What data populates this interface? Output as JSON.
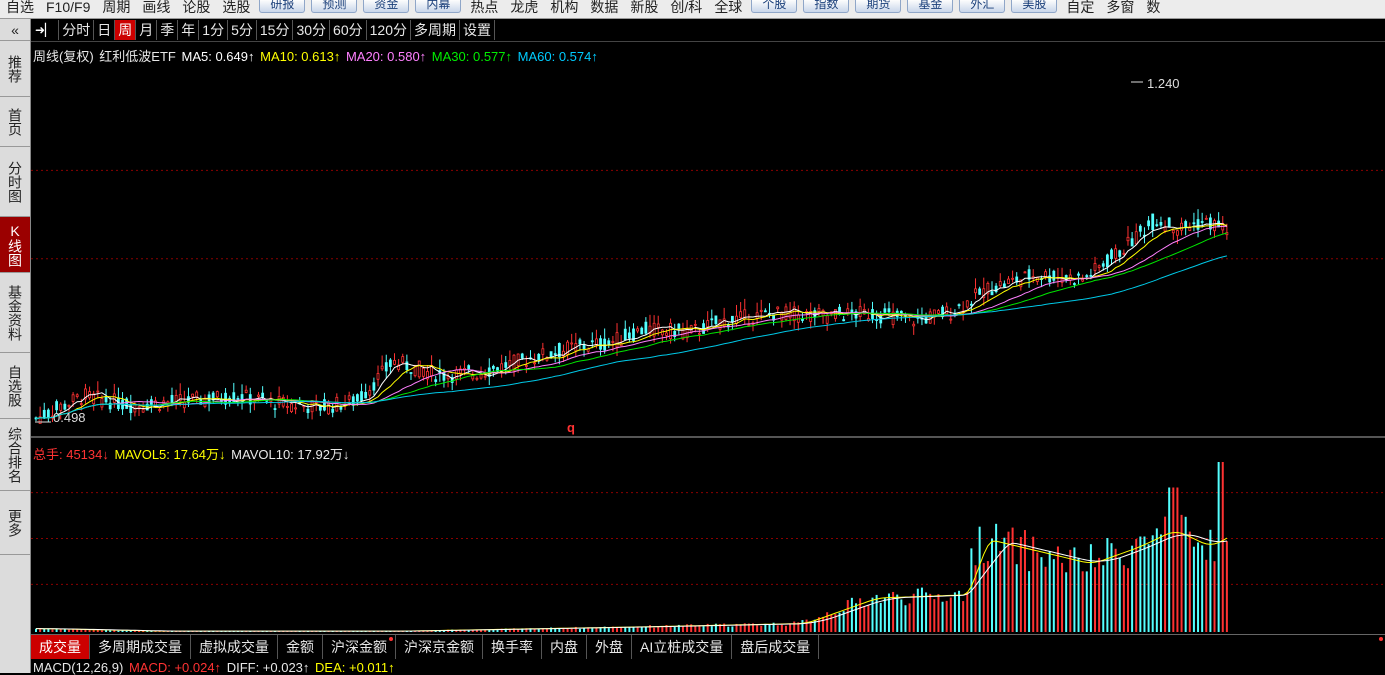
{
  "topbar": {
    "items": [
      "自选",
      "F10/F9",
      "周期",
      "画线",
      "论股",
      "选股"
    ],
    "buttons": [
      "研报",
      "预测",
      "资金",
      "内幕"
    ],
    "items2": [
      "热点",
      "龙虎",
      "机构",
      "数据",
      "新股",
      "创/科",
      "全球"
    ],
    "buttons2": [
      "个股",
      "指数",
      "期货",
      "基金",
      "外汇",
      "美股"
    ],
    "items3": [
      "自定",
      "多窗",
      "数"
    ]
  },
  "sidebar": {
    "collapse_icon": "double-chevron-left-icon",
    "collapse_glyph": "«",
    "items": [
      {
        "label": "推荐",
        "active": false
      },
      {
        "label": "首页",
        "active": false
      },
      {
        "label": "分时图",
        "active": false
      },
      {
        "label": "K线图",
        "active": true
      },
      {
        "label": "基金资料",
        "active": false
      },
      {
        "label": "自选股",
        "active": false
      },
      {
        "label": "综合排名",
        "active": false
      },
      {
        "label": "更多",
        "active": false
      }
    ]
  },
  "period_bar": {
    "pin_icon": "pin-arrow-icon",
    "pin_glyph": "➜▏",
    "items": [
      {
        "label": "分时",
        "active": false
      },
      {
        "label": "日",
        "active": false
      },
      {
        "label": "周",
        "active": true
      },
      {
        "label": "月",
        "active": false
      },
      {
        "label": "季",
        "active": false
      },
      {
        "label": "年",
        "active": false
      },
      {
        "label": "1分",
        "active": false
      },
      {
        "label": "5分",
        "active": false
      },
      {
        "label": "15分",
        "active": false
      },
      {
        "label": "30分",
        "active": false
      },
      {
        "label": "60分",
        "active": false
      },
      {
        "label": "120分",
        "active": false
      },
      {
        "label": "多周期",
        "active": false
      },
      {
        "label": "设置",
        "active": false
      }
    ]
  },
  "ma_legend": {
    "title": "周线(复权)",
    "name": "红利低波ETF",
    "ma5": "MA5: 0.649↑",
    "ma10": "MA10: 0.613↑",
    "ma20": "MA20: 0.580↑",
    "ma30": "MA30: 0.577↑",
    "ma60": "MA60: 0.574↑"
  },
  "price_marks": {
    "high": "1.240",
    "low": "0.498",
    "q_marker": "q"
  },
  "vol_legend": {
    "total": "总手: 45134↓",
    "mavol5": "MAVOL5: 17.64万↓",
    "mavol10": "MAVOL10: 17.92万↓"
  },
  "vol_tabs": [
    {
      "label": "成交量",
      "active": true,
      "dot": false
    },
    {
      "label": "多周期成交量",
      "active": false,
      "dot": false
    },
    {
      "label": "虚拟成交量",
      "active": false,
      "dot": false
    },
    {
      "label": "金额",
      "active": false,
      "dot": false
    },
    {
      "label": "沪深金额",
      "active": false,
      "dot": true
    },
    {
      "label": "沪深京金额",
      "active": false,
      "dot": false
    },
    {
      "label": "换手率",
      "active": false,
      "dot": false
    },
    {
      "label": "内盘",
      "active": false,
      "dot": false
    },
    {
      "label": "外盘",
      "active": false,
      "dot": false
    },
    {
      "label": "AI立桩成交量",
      "active": false,
      "dot": false
    },
    {
      "label": "盘后成交量",
      "active": false,
      "dot": false
    }
  ],
  "macd_legend": {
    "name": "MACD(12,26,9)",
    "macd": "MACD: +0.024↑",
    "diff": "DIFF: +0.023↑",
    "dea": "DEA: +0.011↑"
  },
  "colors": {
    "up": "#ff3232",
    "down": "#54ffff",
    "bg": "#000000",
    "ma5": "#ffffff",
    "ma10": "#ffff00",
    "ma20": "#ff80ff",
    "ma30": "#00e600",
    "ma60": "#00c8e6",
    "grid": "#8b0000",
    "active_tab": "#cc0000"
  },
  "chart_data": {
    "type": "candlestick",
    "price_range": [
      0.498,
      1.24
    ],
    "price_extremes": {
      "high": 1.24,
      "low": 0.498
    },
    "ma_latest": {
      "MA5": 0.649,
      "MA10": 0.613,
      "MA20": 0.58,
      "MA30": 0.577,
      "MA60": 0.574
    },
    "volume_latest": 45134,
    "mavol_latest": {
      "MAVOL5": "17.64万",
      "MAVOL10": "17.92万"
    },
    "price_trend": [
      [
        0.0,
        0.505
      ],
      [
        0.04,
        0.555
      ],
      [
        0.08,
        0.535
      ],
      [
        0.13,
        0.545
      ],
      [
        0.17,
        0.555
      ],
      [
        0.2,
        0.54
      ],
      [
        0.24,
        0.53
      ],
      [
        0.27,
        0.545
      ],
      [
        0.3,
        0.63
      ],
      [
        0.34,
        0.6
      ],
      [
        0.37,
        0.605
      ],
      [
        0.42,
        0.64
      ],
      [
        0.45,
        0.66
      ],
      [
        0.48,
        0.67
      ],
      [
        0.51,
        0.7
      ],
      [
        0.55,
        0.695
      ],
      [
        0.58,
        0.72
      ],
      [
        0.62,
        0.735
      ],
      [
        0.66,
        0.73
      ],
      [
        0.7,
        0.735
      ],
      [
        0.74,
        0.72
      ],
      [
        0.77,
        0.74
      ],
      [
        0.8,
        0.79
      ],
      [
        0.84,
        0.82
      ],
      [
        0.88,
        0.81
      ],
      [
        0.91,
        0.87
      ],
      [
        0.94,
        0.94
      ],
      [
        0.96,
        0.92
      ],
      [
        0.98,
        0.935
      ],
      [
        1.0,
        0.92
      ]
    ],
    "volume_trend": [
      [
        0.0,
        2
      ],
      [
        0.1,
        0.5
      ],
      [
        0.3,
        0.5
      ],
      [
        0.5,
        3
      ],
      [
        0.64,
        5
      ],
      [
        0.7,
        20
      ],
      [
        0.78,
        22
      ],
      [
        0.79,
        55
      ],
      [
        0.85,
        45
      ],
      [
        0.88,
        40
      ],
      [
        0.92,
        50
      ],
      [
        0.95,
        60
      ],
      [
        0.98,
        50
      ],
      [
        1.0,
        58
      ]
    ],
    "volume_max": 100,
    "volume_spikes": [
      [
        0.955,
        85
      ],
      [
        0.995,
        100
      ]
    ]
  }
}
